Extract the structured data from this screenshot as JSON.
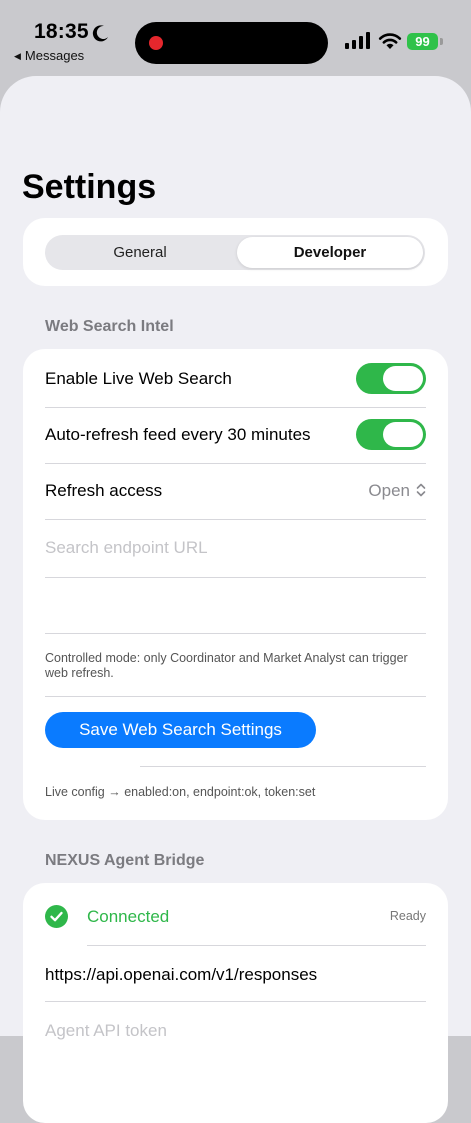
{
  "status_bar": {
    "time": "18:35",
    "back_app": "Messages",
    "battery": "99"
  },
  "page": {
    "title": "Settings"
  },
  "tabs": [
    {
      "label": "General",
      "selected": false
    },
    {
      "label": "Developer",
      "selected": true
    }
  ],
  "web_search": {
    "section_title": "Web Search Intel",
    "enable_label": "Enable Live Web Search",
    "enable_on": true,
    "autorefresh_label": "Auto-refresh feed every 30 minutes",
    "autorefresh_on": true,
    "refresh_access_label": "Refresh access",
    "refresh_access_value": "Open",
    "endpoint_placeholder": "Search endpoint URL",
    "note": "Controlled mode: only Coordinator and Market Analyst can trigger web refresh.",
    "save_label": "Save Web Search Settings",
    "live_config": "Live config → enabled:on, endpoint:ok, token:set"
  },
  "nexus": {
    "section_title": "NEXUS Agent Bridge",
    "status": "Connected",
    "status_badge": "Ready",
    "endpoint": "https://api.openai.com/v1/responses",
    "token_placeholder": "Agent API token"
  },
  "colors": {
    "accent": "#0a7bff",
    "toggle_on": "#2fb74a",
    "connected": "#2fb74a",
    "recording": "#e5272d"
  }
}
